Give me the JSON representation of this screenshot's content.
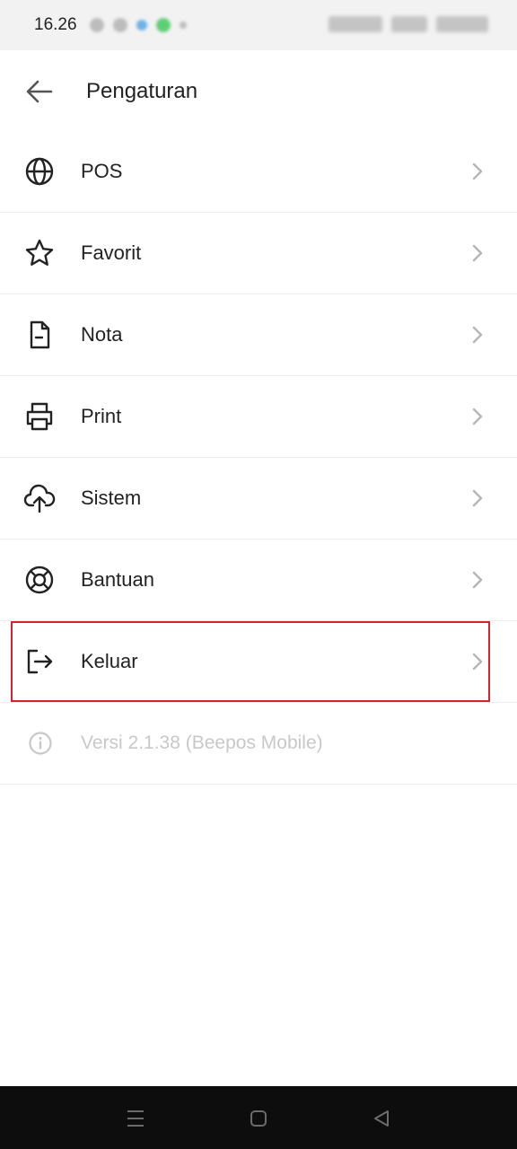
{
  "status_bar": {
    "time": "16.26"
  },
  "header": {
    "title": "Pengaturan",
    "back_icon": "arrow-left-icon"
  },
  "menu": {
    "items": [
      {
        "label": "POS",
        "icon": "globe-icon"
      },
      {
        "label": "Favorit",
        "icon": "star-icon"
      },
      {
        "label": "Nota",
        "icon": "file-icon"
      },
      {
        "label": "Print",
        "icon": "printer-icon"
      },
      {
        "label": "Sistem",
        "icon": "cloud-upload-icon"
      },
      {
        "label": "Bantuan",
        "icon": "lifebuoy-icon"
      },
      {
        "label": "Keluar",
        "icon": "logout-icon"
      }
    ]
  },
  "version": {
    "label": "Versi 2.1.38 (Beepos Mobile)",
    "icon": "info-icon"
  },
  "colors": {
    "highlight": "#d8212a",
    "muted_text": "#c8c8c8",
    "chevron": "#b5b5b5",
    "navbar": "#0d0d0d"
  },
  "nav": {
    "icons": [
      "menu-icon",
      "home-icon",
      "back-triangle-icon"
    ]
  }
}
